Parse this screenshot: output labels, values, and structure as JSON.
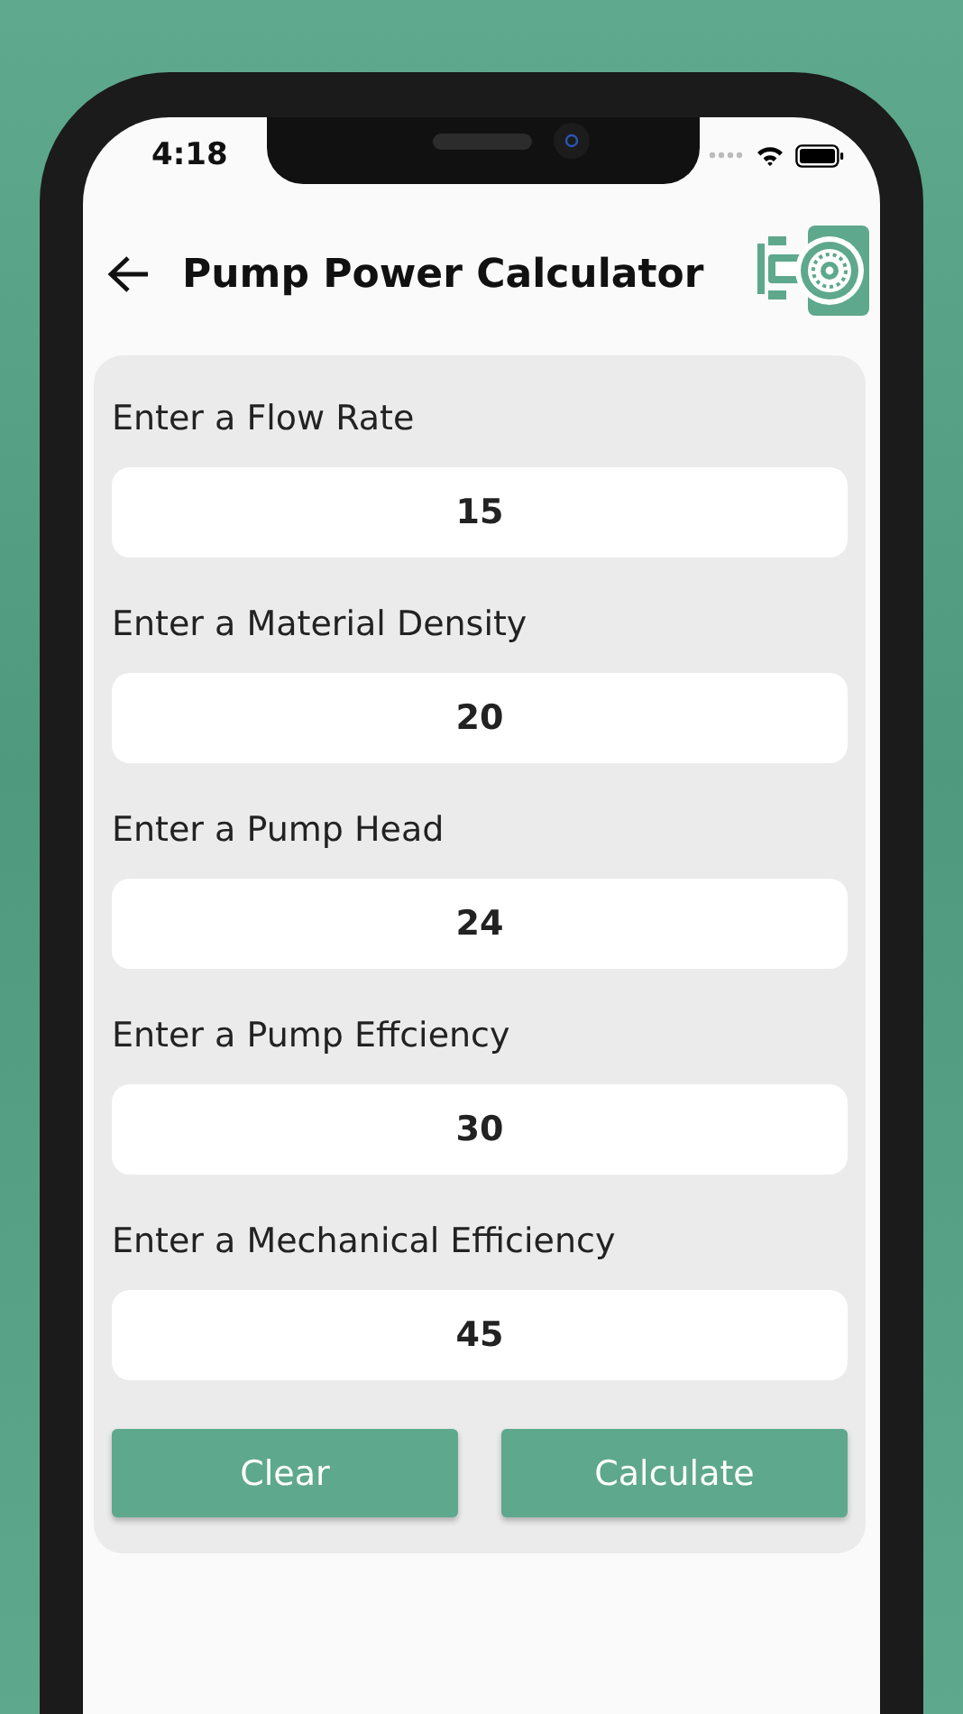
{
  "status_bar": {
    "time": "4:18"
  },
  "header": {
    "title": "Pump Power Calculator"
  },
  "fields": [
    {
      "label": "Enter a Flow Rate",
      "value": "15"
    },
    {
      "label": "Enter a Material Density",
      "value": "20"
    },
    {
      "label": "Enter a Pump Head",
      "value": "24"
    },
    {
      "label": "Enter a Pump Effciency",
      "value": "30"
    },
    {
      "label": "Enter a Mechanical Efficiency",
      "value": "45"
    }
  ],
  "buttons": [
    {
      "label": "Clear"
    },
    {
      "label": "Calculate"
    }
  ]
}
